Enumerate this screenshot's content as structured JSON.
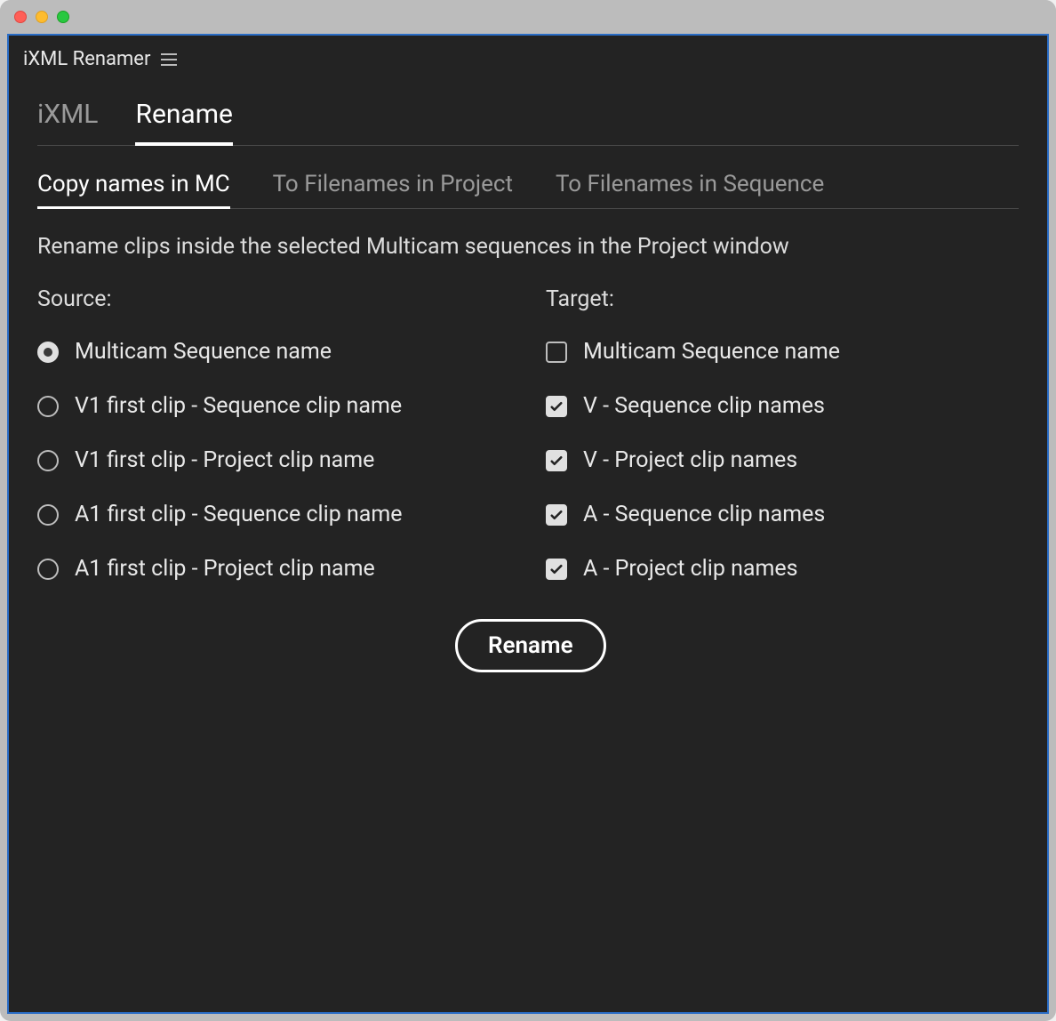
{
  "panel": {
    "title": "iXML Renamer"
  },
  "primaryTabs": [
    {
      "label": "iXML",
      "active": false
    },
    {
      "label": "Rename",
      "active": true
    }
  ],
  "secondaryTabs": [
    {
      "label": "Copy names in MC",
      "active": true
    },
    {
      "label": "To Filenames in Project",
      "active": false
    },
    {
      "label": "To Filenames in Sequence",
      "active": false
    }
  ],
  "description": "Rename clips inside the selected Multicam sequences in the Project window",
  "source": {
    "header": "Source:",
    "options": [
      {
        "label": "Multicam Sequence name",
        "selected": true
      },
      {
        "label": "V1 first clip - Sequence clip name",
        "selected": false
      },
      {
        "label": "V1 first clip - Project clip name",
        "selected": false
      },
      {
        "label": "A1 first clip - Sequence clip name",
        "selected": false
      },
      {
        "label": "A1 first clip - Project clip name",
        "selected": false
      }
    ]
  },
  "target": {
    "header": "Target:",
    "options": [
      {
        "label": "Multicam Sequence name",
        "checked": false
      },
      {
        "label": "V - Sequence clip names",
        "checked": true
      },
      {
        "label": "V - Project clip names",
        "checked": true
      },
      {
        "label": "A - Sequence clip names",
        "checked": true
      },
      {
        "label": "A - Project clip names",
        "checked": true
      }
    ]
  },
  "actionButton": "Rename"
}
